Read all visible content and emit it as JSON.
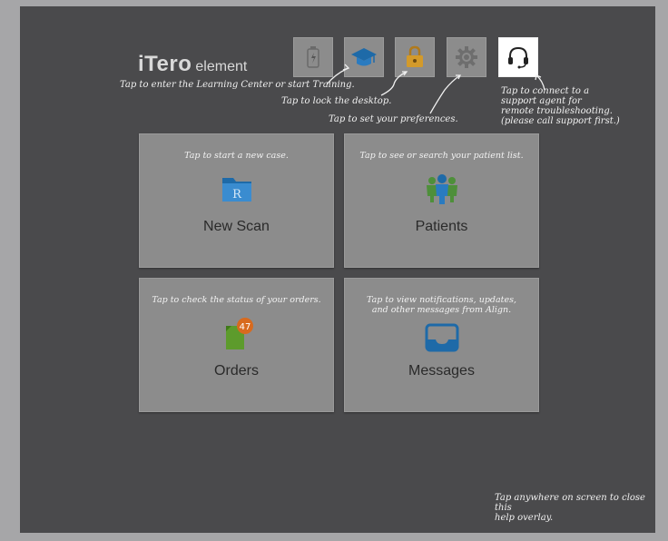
{
  "header": {
    "brand": "iTero",
    "product": "element"
  },
  "toolbar": {
    "buttons": [
      {
        "name": "battery",
        "icon": "battery-icon"
      },
      {
        "name": "learning-center",
        "icon": "graduation-cap-icon"
      },
      {
        "name": "lock",
        "icon": "lock-icon"
      },
      {
        "name": "settings",
        "icon": "gear-icon"
      },
      {
        "name": "support",
        "icon": "headset-icon"
      }
    ]
  },
  "callouts": {
    "learning": "Tap to enter the Learning Center or start Training.",
    "lock": "Tap to lock the desktop.",
    "settings": "Tap to set your preferences.",
    "support": "Tap to connect to a\nsupport agent for\nremote troubleshooting.\n(please call support first.)"
  },
  "tiles": {
    "new_scan": {
      "tip": "Tap to start a new case.",
      "label": "New Scan",
      "icon": "folder-r-icon"
    },
    "patients": {
      "tip": "Tap to see or search your patient list.",
      "label": "Patients",
      "icon": "patients-icon"
    },
    "orders": {
      "tip": "Tap to check the status of your orders.",
      "label": "Orders",
      "icon": "orders-icon",
      "badge": "47"
    },
    "messages": {
      "tip": "Tap to view notifications, updates,\nand other messages from Align.",
      "label": "Messages",
      "icon": "inbox-icon"
    }
  },
  "footer": {
    "close_hint": "Tap anywhere on screen to close this\nhelp overlay."
  },
  "colors": {
    "accent_blue": "#1e6aa8",
    "badge_orange": "#d86a1e",
    "orders_green": "#5d9b2c",
    "patients_green": "#4e8f3a"
  }
}
